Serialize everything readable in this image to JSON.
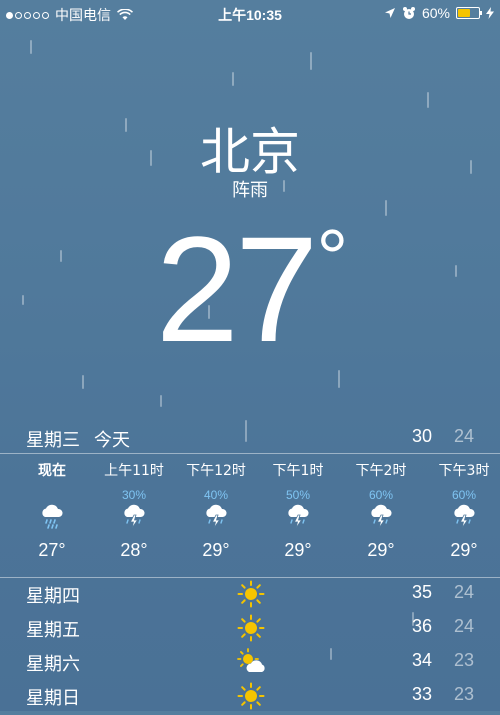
{
  "status_bar": {
    "carrier": "中国电信",
    "time": "上午10:35",
    "battery_percent": "60%",
    "battery_level": 0.6,
    "signal_bars_on": 1,
    "signal_bars_total": 5
  },
  "location": {
    "city": "北京",
    "condition": "阵雨"
  },
  "current": {
    "temperature": "27",
    "degree_symbol": "°"
  },
  "today": {
    "weekday": "星期三",
    "label": "今天",
    "high": "30",
    "low": "24"
  },
  "hourly": [
    {
      "time": "现在",
      "precip": "",
      "icon": "rain-cloud-icon",
      "temp": "27°"
    },
    {
      "time": "上午11时",
      "precip": "30%",
      "icon": "thunderstorm-cloud-icon",
      "temp": "28°"
    },
    {
      "time": "下午12时",
      "precip": "40%",
      "icon": "thunderstorm-cloud-icon",
      "temp": "29°"
    },
    {
      "time": "下午1时",
      "precip": "50%",
      "icon": "thunderstorm-cloud-icon",
      "temp": "29°"
    },
    {
      "time": "下午2时",
      "precip": "60%",
      "icon": "thunderstorm-cloud-icon",
      "temp": "29°"
    },
    {
      "time": "下午3时",
      "precip": "60%",
      "icon": "thunderstorm-cloud-icon",
      "temp": "29°"
    }
  ],
  "daily": [
    {
      "weekday": "星期四",
      "icon": "sun-icon",
      "high": "35",
      "low": "24"
    },
    {
      "weekday": "星期五",
      "icon": "sun-icon",
      "high": "36",
      "low": "24"
    },
    {
      "weekday": "星期六",
      "icon": "partly-cloudy-icon",
      "high": "34",
      "low": "23"
    },
    {
      "weekday": "星期日",
      "icon": "sun-icon",
      "high": "33",
      "low": "23"
    }
  ],
  "colors": {
    "background": "#50799b",
    "precip_text": "#7fc4f2",
    "sun": "#f5c400"
  }
}
